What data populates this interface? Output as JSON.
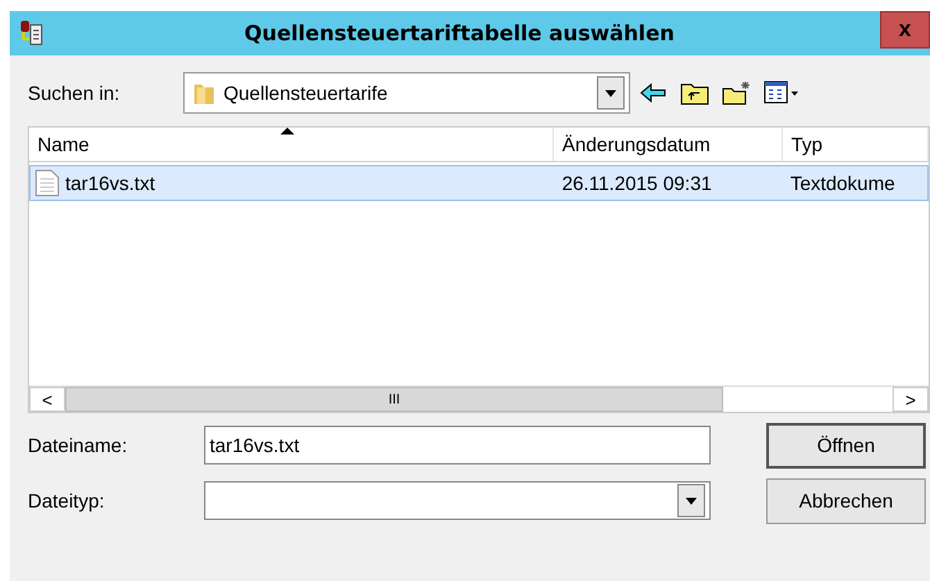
{
  "window": {
    "title": "Quellensteuertariftabelle auswählen",
    "close": "x"
  },
  "look_in": {
    "label": "Suchen in:",
    "value": "Quellensteuertarife"
  },
  "columns": [
    {
      "label": "Name",
      "sorted": true
    },
    {
      "label": "Änderungsdatum",
      "sorted": false
    },
    {
      "label": "Typ",
      "sorted": false
    }
  ],
  "rows": [
    {
      "cells": [
        "tar16vs.txt",
        "26.11.2015 09:31",
        "Textdokume"
      ],
      "selected": true
    }
  ],
  "scrollbar": {
    "thumb": "III",
    "left": "<",
    "right": ">"
  },
  "filename": {
    "label": "Dateiname:",
    "value": "tar16vs.txt"
  },
  "filetype": {
    "label": "Dateityp:"
  },
  "buttons": [
    {
      "label": "Öffnen",
      "default": true
    },
    {
      "label": "Abbrechen",
      "default": false
    }
  ]
}
